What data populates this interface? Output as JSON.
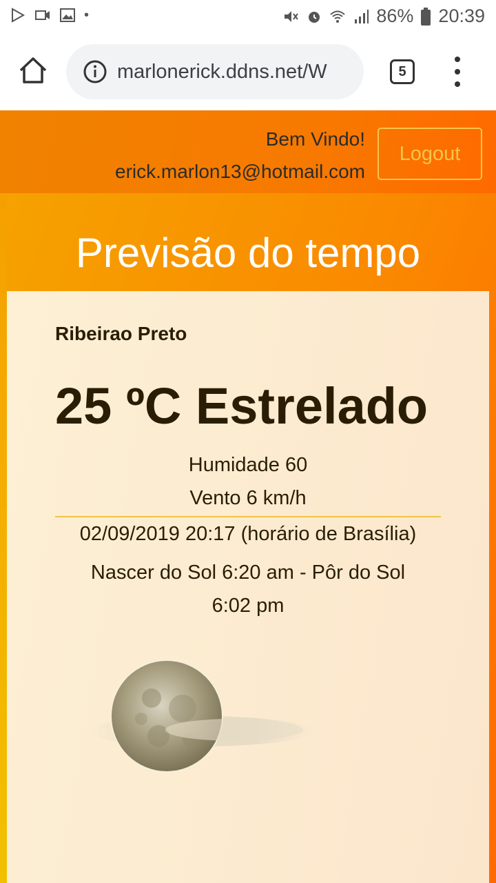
{
  "status_bar": {
    "battery": "86%",
    "time": "20:39"
  },
  "browser": {
    "url": "marlonerick.ddns.net/W",
    "tab_count": "5"
  },
  "header": {
    "greeting": "Bem Vindo!",
    "email": "erick.marlon13@hotmail.com",
    "logout_label": "Logout"
  },
  "page": {
    "title": "Previsão do tempo"
  },
  "weather": {
    "city": "Ribeirao Preto",
    "temperature": "25 ºC Estrelado",
    "humidity": "Humidade 60",
    "wind": "Vento 6 km/h",
    "datetime": "02/09/2019 20:17 (horário de Brasília)",
    "sun": "Nascer do Sol 6:20 am - Pôr do Sol 6:02 pm",
    "icon": "moon-cloud-icon"
  },
  "colors": {
    "accent": "#f7c54a",
    "header_orange": "#f77a00",
    "card_bg": "#fdf0d4"
  }
}
